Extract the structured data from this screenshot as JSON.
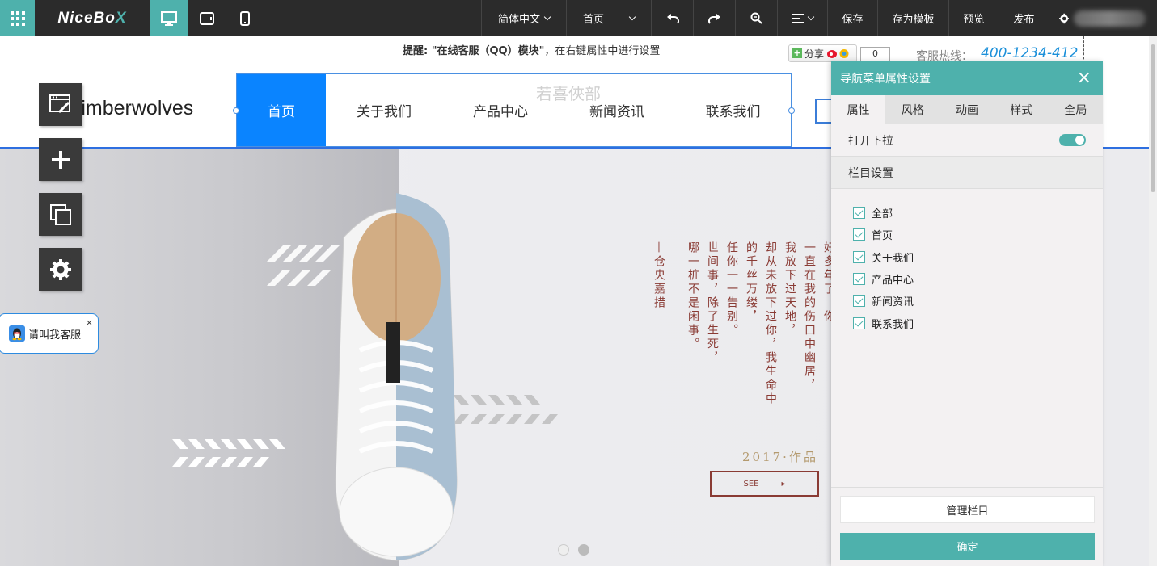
{
  "topbar": {
    "logo_main": "NiceBo",
    "logo_x": "X",
    "language": "简体中文",
    "page": "首页",
    "save": "保存",
    "save_template": "存为模板",
    "preview": "预览",
    "publish": "发布",
    "accent": "#4eb1ac"
  },
  "site": {
    "notice_prefix": "提醒: ",
    "notice_bold": "\"在线客服（QQ）模块\"",
    "notice_suffix": "，在右键属性中进行设置",
    "share_label": "分享",
    "share_count": "0",
    "hotline_label": "客服热线：",
    "hotline": "400-1234-412",
    "brand": "Timberwolves",
    "nav": [
      "首页",
      "关于我们",
      "产品中心",
      "新闻资讯",
      "联系我们"
    ],
    "nav_ghost": "若喜俠部"
  },
  "qq_widget": {
    "label": "请叫我客服",
    "close": "×"
  },
  "banner": {
    "signature": "—仓央嘉措",
    "poem_cols": [
      "好多年了，你",
      "一直在我的伤口中幽居，",
      "我放下过天地，",
      "却从未放下过你，我生命中",
      "的千丝万缕，",
      "任你一一告别。",
      "世间事，除了生死，",
      "哪一桩不是闲事。"
    ],
    "year": "2017·作品",
    "see": "SEE",
    "see_arrow": "▸",
    "text_color": "#8a3b34"
  },
  "panel": {
    "title": "导航菜单属性设置",
    "close": "×",
    "tabs": [
      "属性",
      "风格",
      "动画",
      "样式",
      "全局"
    ],
    "toggle_label": "打开下拉",
    "toggle_on": true,
    "section_title": "栏目设置",
    "checks": [
      "全部",
      "首页",
      "关于我们",
      "产品中心",
      "新闻资讯",
      "联系我们"
    ],
    "manage": "管理栏目",
    "confirm": "确定"
  }
}
